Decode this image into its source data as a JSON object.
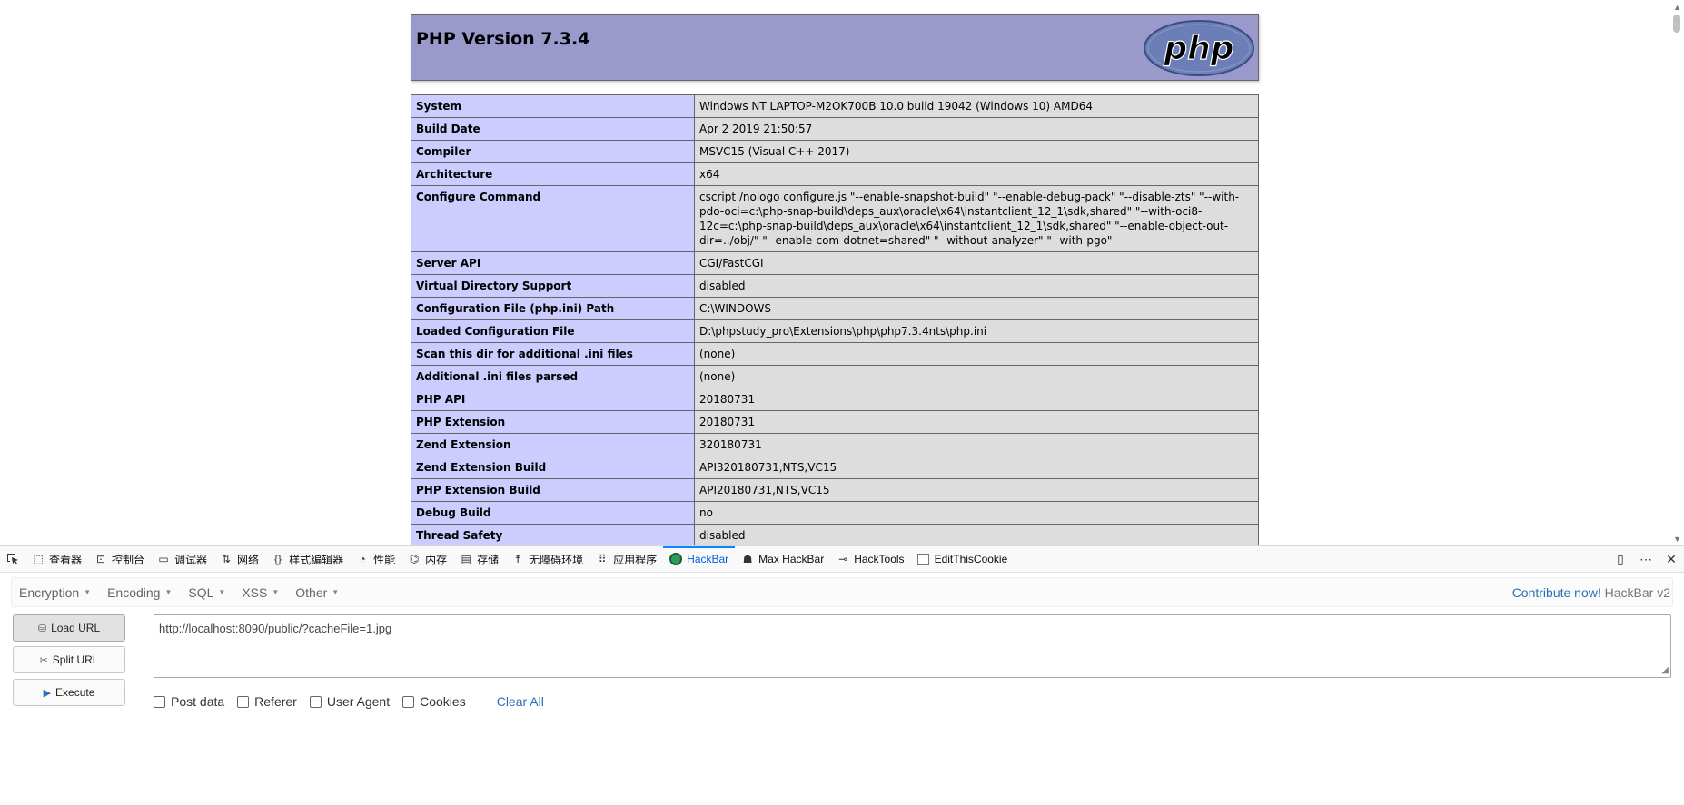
{
  "phpinfo": {
    "title": "PHP Version 7.3.4",
    "logo_text": "php",
    "rows": [
      {
        "key": "System",
        "value": "Windows NT LAPTOP-M2OK700B 10.0 build 19042 (Windows 10) AMD64"
      },
      {
        "key": "Build Date",
        "value": "Apr 2 2019 21:50:57"
      },
      {
        "key": "Compiler",
        "value": "MSVC15 (Visual C++ 2017)"
      },
      {
        "key": "Architecture",
        "value": "x64"
      },
      {
        "key": "Configure Command",
        "value": "cscript /nologo configure.js \"--enable-snapshot-build\" \"--enable-debug-pack\" \"--disable-zts\" \"--with-pdo-oci=c:\\php-snap-build\\deps_aux\\oracle\\x64\\instantclient_12_1\\sdk,shared\" \"--with-oci8-12c=c:\\php-snap-build\\deps_aux\\oracle\\x64\\instantclient_12_1\\sdk,shared\" \"--enable-object-out-dir=../obj/\" \"--enable-com-dotnet=shared\" \"--without-analyzer\" \"--with-pgo\""
      },
      {
        "key": "Server API",
        "value": "CGI/FastCGI"
      },
      {
        "key": "Virtual Directory Support",
        "value": "disabled"
      },
      {
        "key": "Configuration File (php.ini) Path",
        "value": "C:\\WINDOWS"
      },
      {
        "key": "Loaded Configuration File",
        "value": "D:\\phpstudy_pro\\Extensions\\php\\php7.3.4nts\\php.ini"
      },
      {
        "key": "Scan this dir for additional .ini files",
        "value": "(none)"
      },
      {
        "key": "Additional .ini files parsed",
        "value": "(none)"
      },
      {
        "key": "PHP API",
        "value": "20180731"
      },
      {
        "key": "PHP Extension",
        "value": "20180731"
      },
      {
        "key": "Zend Extension",
        "value": "320180731"
      },
      {
        "key": "Zend Extension Build",
        "value": "API320180731,NTS,VC15"
      },
      {
        "key": "PHP Extension Build",
        "value": "API20180731,NTS,VC15"
      },
      {
        "key": "Debug Build",
        "value": "no"
      },
      {
        "key": "Thread Safety",
        "value": "disabled"
      }
    ]
  },
  "devtools": {
    "tabs": [
      {
        "label": "查看器",
        "icon": "inspector-icon",
        "glyph": "⬚"
      },
      {
        "label": "控制台",
        "icon": "console-icon",
        "glyph": "⊡"
      },
      {
        "label": "调试器",
        "icon": "debugger-icon",
        "glyph": "▭"
      },
      {
        "label": "网络",
        "icon": "network-icon",
        "glyph": "⇅"
      },
      {
        "label": "样式编辑器",
        "icon": "style-editor-icon",
        "glyph": "{}"
      },
      {
        "label": "性能",
        "icon": "performance-icon",
        "glyph": "◔"
      },
      {
        "label": "内存",
        "icon": "memory-icon",
        "glyph": "⌬"
      },
      {
        "label": "存储",
        "icon": "storage-icon",
        "glyph": "▤"
      },
      {
        "label": "无障碍环境",
        "icon": "accessibility-icon",
        "glyph": "☨"
      },
      {
        "label": "应用程序",
        "icon": "application-icon",
        "glyph": "⠿"
      },
      {
        "label": "HackBar",
        "icon": "hackbar-icon",
        "glyph": "",
        "active": true
      },
      {
        "label": "Max HackBar",
        "icon": "max-hackbar-icon",
        "glyph": "☗"
      },
      {
        "label": "HackTools",
        "icon": "hacktools-icon",
        "glyph": "⊸"
      },
      {
        "label": "EditThisCookie",
        "icon": "editthiscookie-icon",
        "glyph": ""
      }
    ],
    "accent": "#0a84ff"
  },
  "hackbar": {
    "menu": [
      "Encryption",
      "Encoding",
      "SQL",
      "XSS",
      "Other"
    ],
    "contribute_link": "Contribute now!",
    "version": "HackBar v2",
    "load_url": "Load URL",
    "split_url": "Split URL",
    "execute": "Execute",
    "url_value": "http://localhost:8090/public/?cacheFile=1.jpg",
    "options": [
      "Post data",
      "Referer",
      "User Agent",
      "Cookies"
    ],
    "clear_all": "Clear All"
  }
}
